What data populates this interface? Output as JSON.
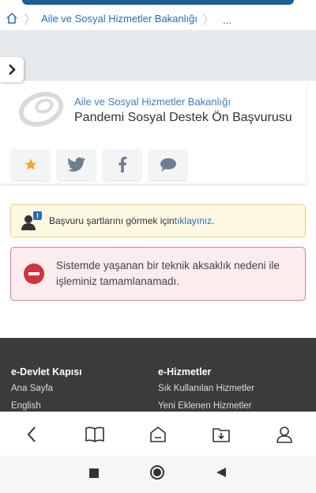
{
  "breadcrumb": {
    "items": [
      "Aile ve Sosyal Hizmetler Bakanlığı"
    ],
    "more": "..."
  },
  "header": {
    "org_name": "Aile ve Sosyal Hizmetler Bakanlığı",
    "page_title": "Pandemi Sosyal Destek Ön Başvurusu"
  },
  "share": [
    "star-icon",
    "twitter-icon",
    "facebook-icon",
    "comment-icon"
  ],
  "info_alert": {
    "text": "Başvuru şartlarını görmek için ",
    "link": "tıklayınız",
    "suffix": "."
  },
  "error_alert": {
    "message": "Sistemde yaşanan bir teknik aksaklık nedeni ile işleminiz tamamlanamadı."
  },
  "footer": {
    "columns": [
      {
        "title": "e-Devlet Kapısı",
        "links": [
          "Ana Sayfa",
          "English"
        ]
      },
      {
        "title": "e-Hizmetler",
        "links": [
          "Sık Kullanılan Hizmetler",
          "Yeni Eklenen Hizmetler"
        ]
      }
    ]
  },
  "colors": {
    "accent": "#2a6db0",
    "error_border": "#d98791",
    "warning_border": "#ecd37a",
    "footer_bg": "#3a3b3d"
  }
}
